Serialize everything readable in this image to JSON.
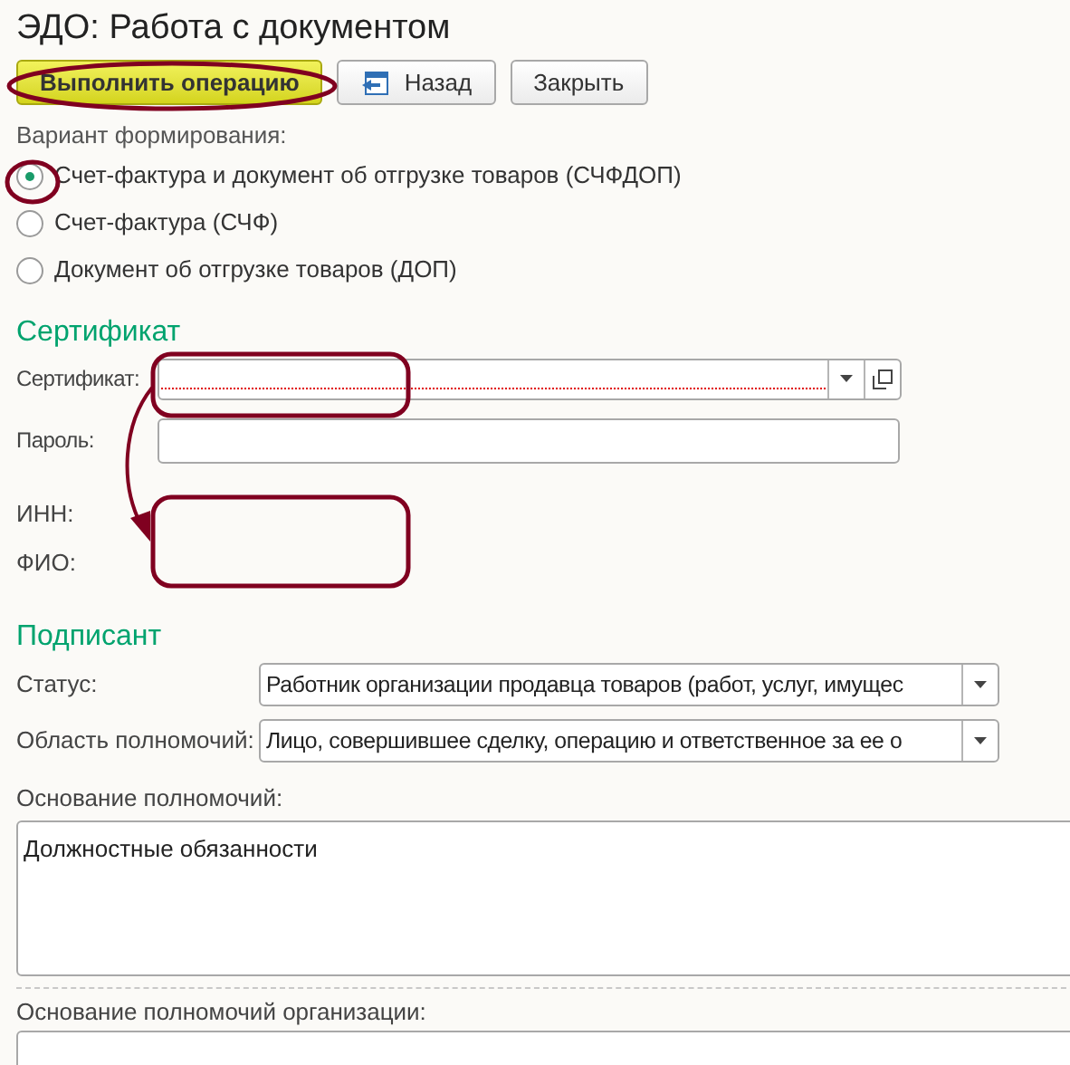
{
  "title": "ЭДО: Работа с документом",
  "buttons": [
    {
      "label": "Выполнить операцию",
      "kind": "primary"
    },
    {
      "label": "Назад",
      "kind": "back"
    },
    {
      "label": "Закрыть",
      "kind": "plain"
    }
  ],
  "format": {
    "label": "Вариант формирования:",
    "options": [
      {
        "label": "Счет-фактура и документ об отгрузке товаров (СЧФДОП)",
        "selected": true
      },
      {
        "label": "Счет-фактура (СЧФ)",
        "selected": false
      },
      {
        "label": "Документ об отгрузке товаров (ДОП)",
        "selected": false
      }
    ]
  },
  "certificate": {
    "heading": "Сертификат",
    "fields": [
      {
        "label": "Сертификат:",
        "kind": "select",
        "required": true
      },
      {
        "label": "Пароль:",
        "kind": "password",
        "required": false
      },
      {
        "label": "ИНН:",
        "kind": "info",
        "required": false
      },
      {
        "label": "ФИО:",
        "kind": "info",
        "required": false
      }
    ]
  },
  "signer": {
    "heading": "Подписант",
    "selects": [
      {
        "label": "Статус:",
        "value": "Работник организации продавца товаров (работ, услуг, имущес"
      },
      {
        "label": "Область полномочий:",
        "value": "Лицо, совершившее сделку, операцию и ответственное за ее о"
      }
    ],
    "basis": {
      "label": "Основание полномочий:",
      "value": "Должностные обязанности"
    },
    "org_basis": {
      "label": "Основание полномочий организации:"
    }
  }
}
